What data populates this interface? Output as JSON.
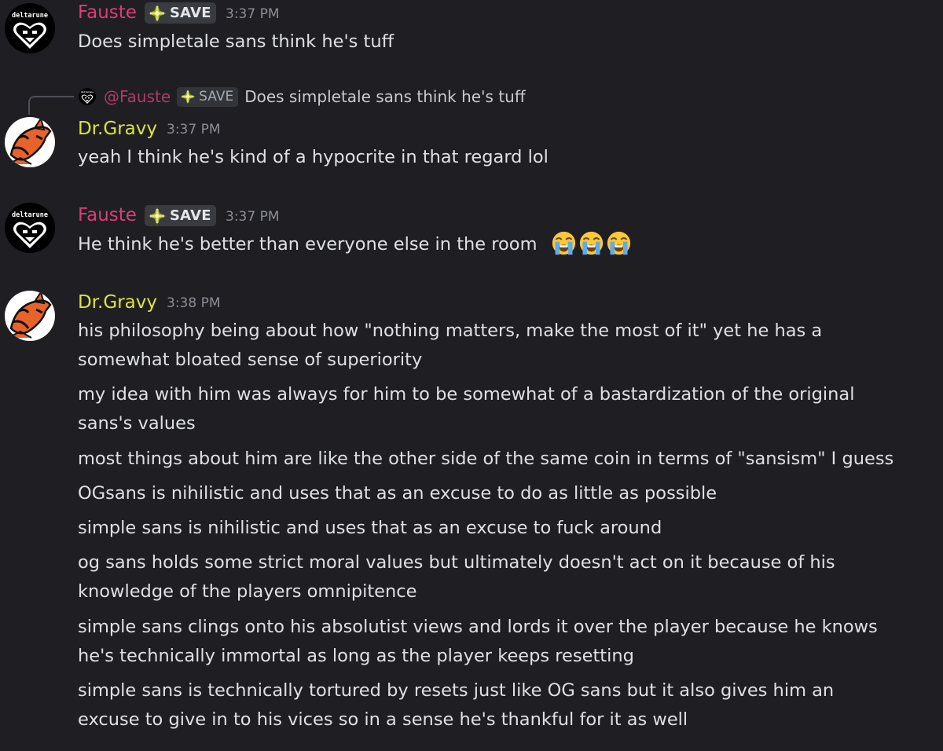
{
  "messages": [
    {
      "author": "Fauste",
      "tag": "SAVE",
      "time": "3:37 PM",
      "avatar_text": "deltarune",
      "lines": [
        "Does simpletale sans think he's tuff"
      ]
    },
    {
      "reply": {
        "mention": "@Fauste",
        "tag": "SAVE",
        "text": "Does simpletale sans think he's tuff",
        "avatar_text": "deltarune"
      },
      "author": "Dr.Gravy",
      "time": "3:37 PM",
      "lines": [
        "yeah I think he's kind of a hypocrite in that regard lol"
      ]
    },
    {
      "author": "Fauste",
      "tag": "SAVE",
      "time": "3:37 PM",
      "avatar_text": "deltarune",
      "lines": [
        "He think he's better than everyone else in the room"
      ],
      "emojis": [
        "loudly-crying-face",
        "loudly-crying-face",
        "loudly-crying-face"
      ]
    },
    {
      "author": "Dr.Gravy",
      "time": "3:38 PM",
      "lines": [
        "his philosophy being about how \"nothing matters, make the most of it\" yet he has a",
        "somewhat bloated sense of superiority",
        "my idea with him was always for him to be somewhat of a bastardization of the original",
        "sans's values",
        "most things about him are like the other side of the same coin in terms of \"sansism\" I guess",
        "OGsans is nihilistic and uses that as an excuse to do as little as possible",
        "simple sans is nihilistic and uses that as an excuse to fuck around",
        "og sans holds some strict moral values but ultimately doesn't act on it because of his",
        "knowledge of the players omnipitence",
        "simple sans clings onto his absolutist views and lords it over the player because he knows",
        "he's technically immortal as long as the player keeps resetting",
        "simple sans is technically tortured by resets just like OG sans but it also gives him an",
        "excuse to give in to his vices so in a sense he's thankful for it as well"
      ]
    }
  ],
  "colors": {
    "background": "#1f1f23",
    "fauste_name": "#dc3d77",
    "gravy_name": "#d8e63f",
    "timestamp": "#8c8e96",
    "text": "#dfe0e4"
  }
}
